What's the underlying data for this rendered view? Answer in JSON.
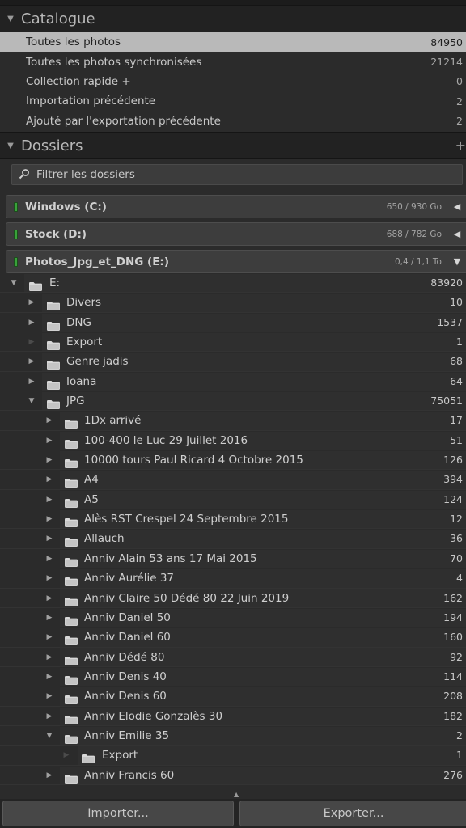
{
  "catalogue": {
    "title": "Catalogue",
    "items": [
      {
        "label": "Toutes les photos",
        "count": "84950",
        "selected": true
      },
      {
        "label": "Toutes les photos synchronisées",
        "count": "21214"
      },
      {
        "label": "Collection rapide +",
        "count": "0"
      },
      {
        "label": "Importation précédente",
        "count": "2"
      },
      {
        "label": "Ajouté par l'exportation précédente",
        "count": "2"
      }
    ]
  },
  "dossiers": {
    "title": "Dossiers",
    "add_icon": "plus-icon",
    "filter_placeholder": "Filtrer les dossiers",
    "volumes": [
      {
        "name": "Windows (C:)",
        "size": "650 / 930 Go",
        "expanded": false
      },
      {
        "name": "Stock (D:)",
        "size": "688 / 782 Go",
        "expanded": false
      },
      {
        "name": "Photos_Jpg_et_DNG (E:)",
        "size": "0,4 / 1,1 To",
        "expanded": true
      }
    ],
    "tree": [
      {
        "label": "E:",
        "count": "83920",
        "level": 0,
        "disclosure": "expanded"
      },
      {
        "label": "Divers",
        "count": "10",
        "level": 1,
        "disclosure": "collapsed"
      },
      {
        "label": "DNG",
        "count": "1537",
        "level": 1,
        "disclosure": "collapsed"
      },
      {
        "label": "Export",
        "count": "1",
        "level": 1,
        "disclosure": "empty"
      },
      {
        "label": "Genre jadis",
        "count": "68",
        "level": 1,
        "disclosure": "collapsed"
      },
      {
        "label": "Ioana",
        "count": "64",
        "level": 1,
        "disclosure": "collapsed"
      },
      {
        "label": "JPG",
        "count": "75051",
        "level": 1,
        "disclosure": "expanded"
      },
      {
        "label": "1Dx arrivé",
        "count": "17",
        "level": 2,
        "disclosure": "collapsed"
      },
      {
        "label": "100-400 le Luc 29 Juillet 2016",
        "count": "51",
        "level": 2,
        "disclosure": "collapsed"
      },
      {
        "label": "10000 tours Paul Ricard 4 Octobre 2015",
        "count": "126",
        "level": 2,
        "disclosure": "collapsed"
      },
      {
        "label": "A4",
        "count": "394",
        "level": 2,
        "disclosure": "collapsed"
      },
      {
        "label": "A5",
        "count": "124",
        "level": 2,
        "disclosure": "collapsed"
      },
      {
        "label": "Alès RST Crespel 24 Septembre 2015",
        "count": "12",
        "level": 2,
        "disclosure": "collapsed"
      },
      {
        "label": "Allauch",
        "count": "36",
        "level": 2,
        "disclosure": "collapsed"
      },
      {
        "label": "Anniv Alain 53 ans 17 Mai 2015",
        "count": "70",
        "level": 2,
        "disclosure": "collapsed"
      },
      {
        "label": "Anniv Aurélie 37",
        "count": "4",
        "level": 2,
        "disclosure": "collapsed"
      },
      {
        "label": "Anniv Claire 50 Dédé 80 22 Juin 2019",
        "count": "162",
        "level": 2,
        "disclosure": "collapsed"
      },
      {
        "label": "Anniv Daniel 50",
        "count": "194",
        "level": 2,
        "disclosure": "collapsed"
      },
      {
        "label": "Anniv Daniel 60",
        "count": "160",
        "level": 2,
        "disclosure": "collapsed"
      },
      {
        "label": "Anniv Dédé 80",
        "count": "92",
        "level": 2,
        "disclosure": "collapsed"
      },
      {
        "label": "Anniv Denis 40",
        "count": "114",
        "level": 2,
        "disclosure": "collapsed"
      },
      {
        "label": "Anniv Denis 60",
        "count": "208",
        "level": 2,
        "disclosure": "collapsed"
      },
      {
        "label": "Anniv Elodie Gonzalès 30",
        "count": "182",
        "level": 2,
        "disclosure": "collapsed"
      },
      {
        "label": "Anniv Emilie 35",
        "count": "2",
        "level": 2,
        "disclosure": "expanded"
      },
      {
        "label": "Export",
        "count": "1",
        "level": 3,
        "disclosure": "empty"
      },
      {
        "label": "Anniv Francis 60",
        "count": "276",
        "level": 2,
        "disclosure": "collapsed"
      }
    ]
  },
  "footer": {
    "import_label": "Importer...",
    "export_label": "Exporter..."
  },
  "colors": {
    "panel_bg": "#2b2b2b",
    "header_bg": "#222222",
    "selected_row": "#b9b9b9",
    "volume_led": "#39a23a"
  }
}
